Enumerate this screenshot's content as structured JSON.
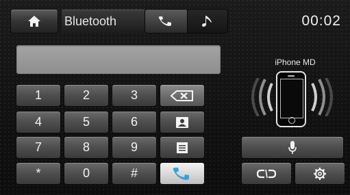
{
  "header": {
    "title": "Bluetooth",
    "home_icon": "home-icon",
    "tabs": [
      {
        "id": "phone",
        "icon": "handset-icon",
        "selected": true
      },
      {
        "id": "music",
        "icon": "music-note-icon",
        "selected": false
      }
    ],
    "clock": "00:02"
  },
  "dialer": {
    "display_value": "",
    "keys": [
      {
        "label": "1"
      },
      {
        "label": "2"
      },
      {
        "label": "3"
      },
      {
        "label": "4"
      },
      {
        "label": "5"
      },
      {
        "label": "6"
      },
      {
        "label": "7"
      },
      {
        "label": "8"
      },
      {
        "label": "9"
      },
      {
        "label": "*"
      },
      {
        "label": "0"
      },
      {
        "label": "#"
      }
    ],
    "side_buttons": [
      {
        "id": "backspace",
        "icon": "backspace-icon"
      },
      {
        "id": "contacts",
        "icon": "contacts-icon"
      },
      {
        "id": "call-log",
        "icon": "list-icon"
      },
      {
        "id": "call",
        "icon": "handset-icon"
      }
    ]
  },
  "device": {
    "name": "iPhone MD",
    "icon": "smartphone-icon"
  },
  "actions": [
    {
      "id": "voice",
      "icon": "microphone-icon"
    },
    {
      "id": "pair",
      "icon": "link-icon"
    },
    {
      "id": "settings",
      "icon": "gear-icon"
    }
  ],
  "colors": {
    "background": "#121212",
    "button": "#505050",
    "call_button": "#d8d8d8",
    "display": "#9a9a9a",
    "text": "#f2f2f2"
  }
}
